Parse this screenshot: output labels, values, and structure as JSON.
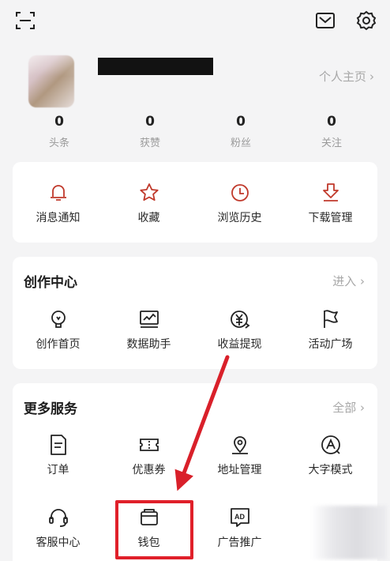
{
  "header": {
    "scan_icon": "scan-icon",
    "mail_icon": "mail-icon",
    "settings_icon": "gear-icon"
  },
  "profile": {
    "link": "个人主页",
    "chevron": "›"
  },
  "stats": [
    {
      "num": "0",
      "label": "头条"
    },
    {
      "num": "0",
      "label": "获赞"
    },
    {
      "num": "0",
      "label": "粉丝"
    },
    {
      "num": "0",
      "label": "关注"
    }
  ],
  "quick": [
    {
      "label": "消息通知",
      "icon": "bell-icon"
    },
    {
      "label": "收藏",
      "icon": "star-icon"
    },
    {
      "label": "浏览历史",
      "icon": "clock-icon"
    },
    {
      "label": "下载管理",
      "icon": "download-icon"
    }
  ],
  "creation": {
    "title": "创作中心",
    "link": "进入 ›",
    "items": [
      {
        "label": "创作首页",
        "icon": "bulb-icon"
      },
      {
        "label": "数据助手",
        "icon": "chart-icon"
      },
      {
        "label": "收益提现",
        "icon": "yuan-icon"
      },
      {
        "label": "活动广场",
        "icon": "flag-icon"
      }
    ]
  },
  "services": {
    "title": "更多服务",
    "link": "全部 ›",
    "items": [
      {
        "label": "订单",
        "icon": "order-icon"
      },
      {
        "label": "优惠券",
        "icon": "coupon-icon"
      },
      {
        "label": "地址管理",
        "icon": "location-icon"
      },
      {
        "label": "大字模式",
        "icon": "font-size-icon"
      },
      {
        "label": "客服中心",
        "icon": "headset-icon"
      },
      {
        "label": "钱包",
        "icon": "wallet-icon"
      },
      {
        "label": "广告推广",
        "icon": "ad-icon"
      }
    ]
  },
  "colors": {
    "accent": "#c0392b",
    "highlight": "#e0202a"
  }
}
